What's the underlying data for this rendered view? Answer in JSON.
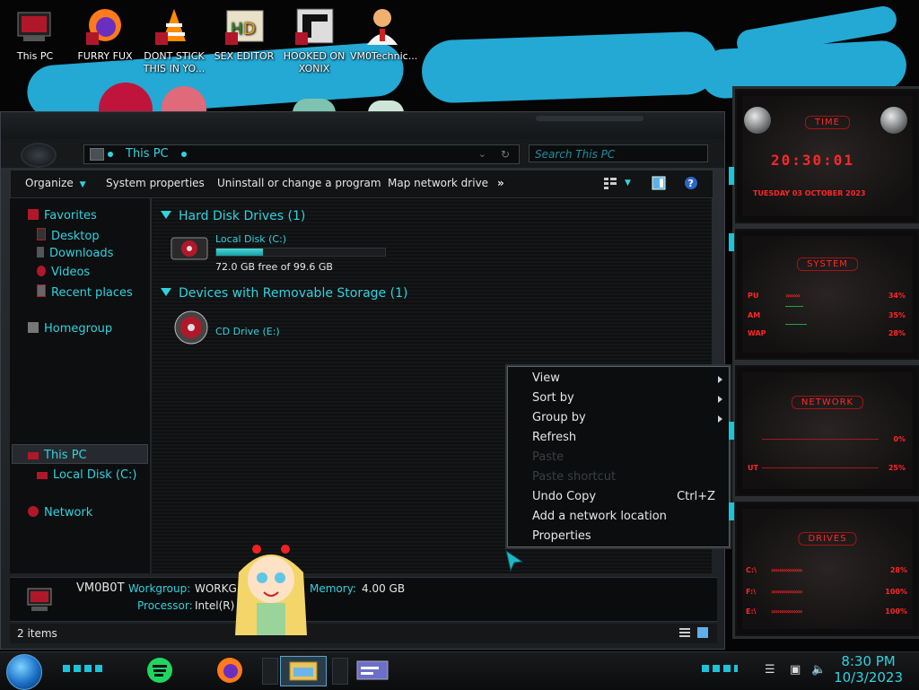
{
  "desktop": {
    "icons": [
      {
        "label": "This PC"
      },
      {
        "label": "FURRY FUX"
      },
      {
        "label": "DONT STICK THIS IN YO..."
      },
      {
        "label": "SEX EDITOR"
      },
      {
        "label": "HOOKED ON XONIX"
      },
      {
        "label": "VM0Technic..."
      }
    ]
  },
  "explorer": {
    "address_path": "This PC",
    "search_placeholder": "Search This PC",
    "commands": {
      "organize": "Organize",
      "system_properties": "System properties",
      "uninstall": "Uninstall or change a program",
      "map_drive": "Map network drive",
      "more": "»"
    },
    "nav": {
      "favorites": "Favorites",
      "desktop": "Desktop",
      "downloads": "Downloads",
      "videos": "Videos",
      "recent": "Recent places",
      "homegroup": "Homegroup",
      "this_pc": "This PC",
      "local_disk": "Local Disk (C:)",
      "network": "Network"
    },
    "groups": {
      "hdd_header": "Hard Disk Drives (1)",
      "removable_header": "Devices with Removable Storage (1)"
    },
    "drives": {
      "c_label": "Local Disk (C:)",
      "c_free": "72.0 GB free of 99.6 GB",
      "c_used_fraction": 0.277,
      "cd_label": "CD Drive (E:)"
    },
    "details": {
      "computer_name": "VM0B0T",
      "workgroup_key": "Workgroup:",
      "workgroup_val": "WORKG",
      "memory_key": "Memory:",
      "memory_val": "4.00 GB",
      "processor_key": "Processor:",
      "processor_val": "Intel(R)"
    },
    "status": {
      "items": "2 items"
    }
  },
  "context_menu": {
    "view": "View",
    "sort_by": "Sort by",
    "group_by": "Group by",
    "refresh": "Refresh",
    "paste": "Paste",
    "paste_shortcut": "Paste shortcut",
    "undo_copy": "Undo Copy",
    "undo_shortcut": "Ctrl+Z",
    "add_network": "Add a network location",
    "properties": "Properties"
  },
  "gadgets": {
    "time": {
      "title": "TIME",
      "clock": "20:30:01",
      "date": "TUESDAY 03 OCTOBER 2023"
    },
    "system": {
      "title": "SYSTEM",
      "cpu_label": "PU",
      "cpu_val": "34%",
      "ram_label": "AM",
      "ram_val": "35%",
      "swap_label": "WAP",
      "swap_val": "28%"
    },
    "network": {
      "title": "NETWORK",
      "in_val": "0%",
      "out_label": "UT",
      "out_val": "25%"
    },
    "drives": {
      "title": "DRIVES",
      "c_label": "C:\\",
      "c_val": "28%",
      "f_label": "F:\\",
      "f_val": "100%",
      "e_label": "E:\\",
      "e_val": "100%"
    }
  },
  "taskbar": {
    "time": "8:30 PM",
    "date": "10/3/2023"
  },
  "colors": {
    "accent": "#2fd3e0",
    "gadget_red": "#ff2626"
  }
}
